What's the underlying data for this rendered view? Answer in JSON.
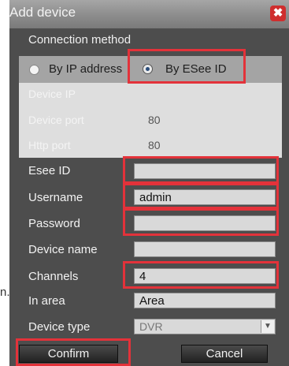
{
  "stray_text": "n.",
  "dialog": {
    "title": "Add device",
    "close_icon": "close-icon"
  },
  "connection": {
    "section_title": "Connection method",
    "options": [
      {
        "label": "By IP address",
        "selected": false
      },
      {
        "label": "By ESee ID",
        "selected": true
      }
    ]
  },
  "ip_fields": {
    "device_ip": {
      "label": "Device IP",
      "value": ""
    },
    "device_port": {
      "label": "Device port",
      "value": "80"
    },
    "http_port": {
      "label": "Http port",
      "value": "80"
    }
  },
  "fields": {
    "esee_id": {
      "label": "Esee ID",
      "value": ""
    },
    "username": {
      "label": "Username",
      "value": "admin"
    },
    "password": {
      "label": "Password",
      "value": ""
    },
    "device_name": {
      "label": "Device name",
      "value": ""
    },
    "channels": {
      "label": "Channels",
      "value": "4"
    },
    "area": {
      "label": "In area",
      "value": "Area"
    },
    "device_type": {
      "label": "Device type",
      "value": "DVR"
    }
  },
  "buttons": {
    "confirm": "Confirm",
    "cancel": "Cancel"
  },
  "colors": {
    "highlight": "#e3323a",
    "dialog_bg": "#4d4d4d",
    "titlebar": "#8c8c8c",
    "close_button": "#cf2e2e"
  }
}
